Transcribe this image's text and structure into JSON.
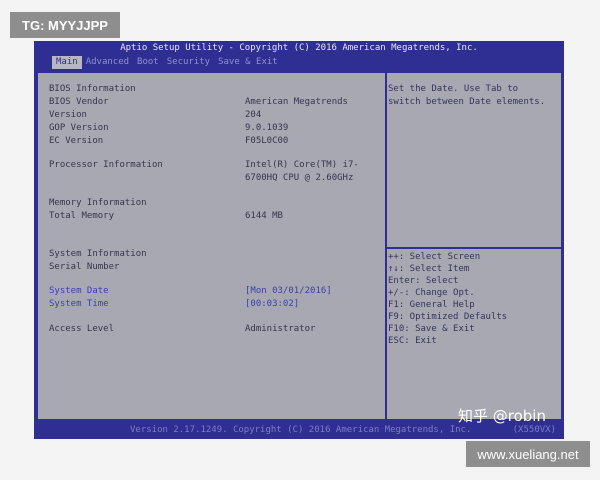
{
  "watermarks": {
    "top": "TG: MYYJJPP",
    "bottom": "www.xueliang.net",
    "zhihu": "知乎 @robin"
  },
  "title": "Aptio Setup Utility - Copyright (C) 2016 American Megatrends, Inc.",
  "menu": [
    "Main",
    "Advanced",
    "Boot",
    "Security",
    "Save & Exit"
  ],
  "active_menu": "Main",
  "bios_info": {
    "header": "BIOS Information",
    "vendor_label": "BIOS Vendor",
    "vendor_value": "American Megatrends",
    "version_label": "Version",
    "version_value": "204",
    "gop_label": "GOP Version",
    "gop_value": "9.0.1039",
    "ec_label": "EC Version",
    "ec_value": "F05L0C00"
  },
  "processor": {
    "label": "Processor Information",
    "value_line1": "Intel(R) Core(TM) i7-",
    "value_line2": "6700HQ CPU @ 2.60GHz"
  },
  "memory": {
    "header": "Memory Information",
    "total_label": "Total Memory",
    "total_value": "6144 MB"
  },
  "system": {
    "header": "System Information",
    "serial_label": "Serial Number",
    "date_label": "System Date",
    "date_value": "[Mon 03/01/2016]",
    "time_label": "System Time",
    "time_value": "[00:03:02]",
    "access_label": "Access Level",
    "access_value": "Administrator"
  },
  "help_text": [
    "Set the Date. Use Tab to",
    "switch between Date elements."
  ],
  "key_help": [
    "++: Select Screen",
    "↑↓: Select Item",
    "Enter: Select",
    "+/-: Change Opt.",
    "F1: General Help",
    "F9: Optimized Defaults",
    "F10: Save & Exit",
    "ESC: Exit"
  ],
  "footer": {
    "version": "Version 2.17.1249. Copyright (C) 2016 American Megatrends, Inc.",
    "model": "(X550VX)"
  }
}
